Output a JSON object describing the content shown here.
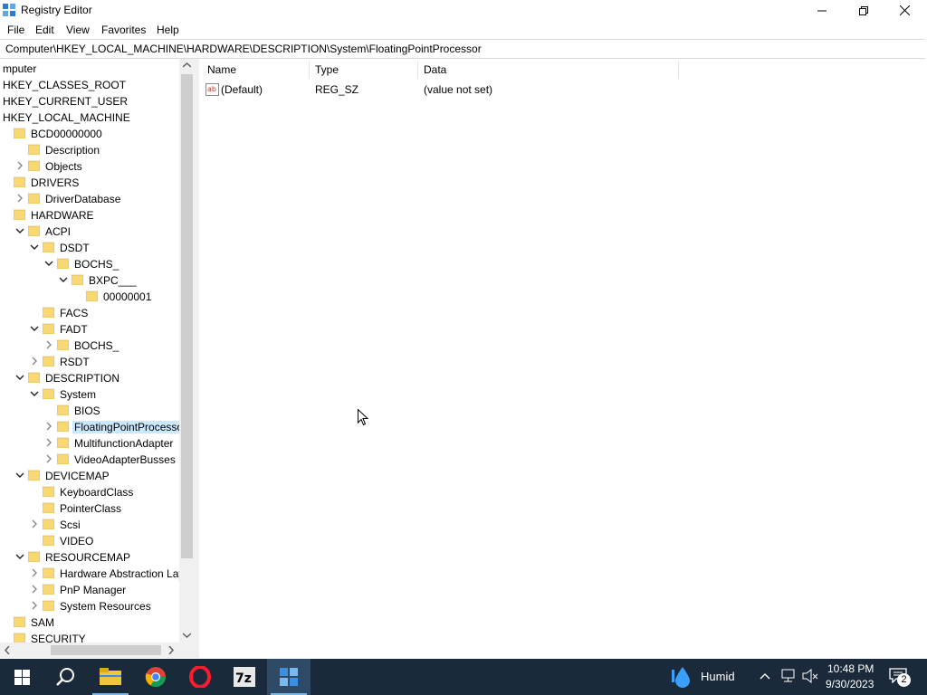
{
  "window": {
    "title": "Registry Editor"
  },
  "menu": [
    "File",
    "Edit",
    "View",
    "Favorites",
    "Help"
  ],
  "address": "Computer\\HKEY_LOCAL_MACHINE\\HARDWARE\\DESCRIPTION\\System\\FloatingPointProcessor",
  "tree": [
    {
      "label": "mputer",
      "level": 0,
      "toggle": "none",
      "folder": false
    },
    {
      "label": "HKEY_CLASSES_ROOT",
      "level": 0,
      "toggle": "none",
      "folder": false
    },
    {
      "label": "HKEY_CURRENT_USER",
      "level": 0,
      "toggle": "none",
      "folder": false
    },
    {
      "label": "HKEY_LOCAL_MACHINE",
      "level": 0,
      "toggle": "none",
      "folder": false
    },
    {
      "label": "BCD00000000",
      "level": 1,
      "toggle": "none",
      "folder": true
    },
    {
      "label": "Description",
      "level": 2,
      "toggle": "none",
      "folder": true
    },
    {
      "label": "Objects",
      "level": 2,
      "toggle": "collapsed",
      "folder": true
    },
    {
      "label": "DRIVERS",
      "level": 1,
      "toggle": "none",
      "folder": true
    },
    {
      "label": "DriverDatabase",
      "level": 2,
      "toggle": "collapsed",
      "folder": true
    },
    {
      "label": "HARDWARE",
      "level": 1,
      "toggle": "none",
      "folder": true
    },
    {
      "label": "ACPI",
      "level": 2,
      "toggle": "expanded",
      "folder": true
    },
    {
      "label": "DSDT",
      "level": 3,
      "toggle": "expanded",
      "folder": true
    },
    {
      "label": "BOCHS_",
      "level": 4,
      "toggle": "expanded",
      "folder": true
    },
    {
      "label": "BXPC___",
      "level": 5,
      "toggle": "expanded",
      "folder": true
    },
    {
      "label": "00000001",
      "level": 6,
      "toggle": "none",
      "folder": true
    },
    {
      "label": "FACS",
      "level": 3,
      "toggle": "none",
      "folder": true
    },
    {
      "label": "FADT",
      "level": 3,
      "toggle": "expanded",
      "folder": true
    },
    {
      "label": "BOCHS_",
      "level": 4,
      "toggle": "collapsed",
      "folder": true
    },
    {
      "label": "RSDT",
      "level": 3,
      "toggle": "collapsed",
      "folder": true
    },
    {
      "label": "DESCRIPTION",
      "level": 2,
      "toggle": "expanded",
      "folder": true
    },
    {
      "label": "System",
      "level": 3,
      "toggle": "expanded",
      "folder": true
    },
    {
      "label": "BIOS",
      "level": 4,
      "toggle": "none",
      "folder": true
    },
    {
      "label": "FloatingPointProcessor",
      "level": 4,
      "toggle": "collapsed",
      "folder": true,
      "selected": true
    },
    {
      "label": "MultifunctionAdapter",
      "level": 4,
      "toggle": "collapsed",
      "folder": true
    },
    {
      "label": "VideoAdapterBusses",
      "level": 4,
      "toggle": "collapsed",
      "folder": true
    },
    {
      "label": "DEVICEMAP",
      "level": 2,
      "toggle": "expanded",
      "folder": true
    },
    {
      "label": "KeyboardClass",
      "level": 3,
      "toggle": "none",
      "folder": true
    },
    {
      "label": "PointerClass",
      "level": 3,
      "toggle": "none",
      "folder": true
    },
    {
      "label": "Scsi",
      "level": 3,
      "toggle": "collapsed",
      "folder": true
    },
    {
      "label": "VIDEO",
      "level": 3,
      "toggle": "none",
      "folder": true
    },
    {
      "label": "RESOURCEMAP",
      "level": 2,
      "toggle": "expanded",
      "folder": true
    },
    {
      "label": "Hardware Abstraction Layer",
      "level": 3,
      "toggle": "collapsed",
      "folder": true
    },
    {
      "label": "PnP Manager",
      "level": 3,
      "toggle": "collapsed",
      "folder": true
    },
    {
      "label": "System Resources",
      "level": 3,
      "toggle": "collapsed",
      "folder": true
    },
    {
      "label": "SAM",
      "level": 1,
      "toggle": "none",
      "folder": true
    },
    {
      "label": "SECURITY",
      "level": 1,
      "toggle": "none",
      "folder": true
    }
  ],
  "list": {
    "columns": [
      "Name",
      "Type",
      "Data"
    ],
    "rows": [
      {
        "name": "(Default)",
        "type": "REG_SZ",
        "data": "(value not set)",
        "icon": "string-value-icon"
      }
    ]
  },
  "taskbar": {
    "apps": [
      "start-icon",
      "search-icon",
      "file-explorer-icon",
      "chrome-icon",
      "opera-icon",
      "7zip-icon",
      "regedit-icon"
    ],
    "weather": "Humid",
    "time": "10:48 PM",
    "date": "9/30/2023",
    "notifications": "2"
  },
  "colors": {
    "selection": "#cce8ff",
    "taskbar": "#1b2a3a",
    "folder": "#f8d775"
  }
}
